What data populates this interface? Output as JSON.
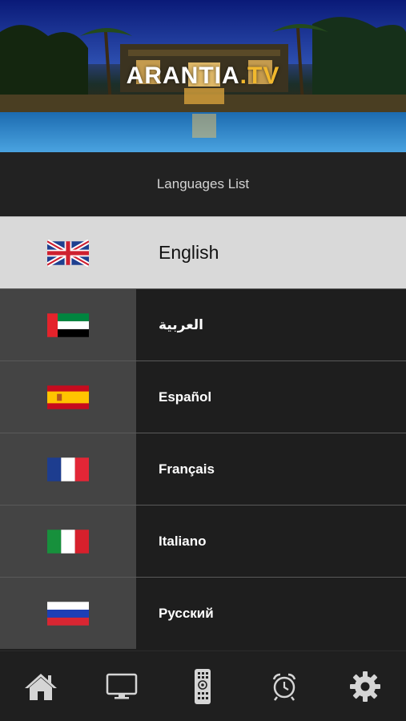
{
  "header": {
    "logo_main": "ARANTIA",
    "logo_tld": ".TV"
  },
  "title": "Languages List",
  "languages": [
    {
      "label": "English",
      "flag": "uk-flag",
      "selected": true
    },
    {
      "label": "العربية",
      "flag": "uae-flag",
      "selected": false
    },
    {
      "label": "Español",
      "flag": "spain-flag",
      "selected": false
    },
    {
      "label": "Français",
      "flag": "france-flag",
      "selected": false
    },
    {
      "label": "Italiano",
      "flag": "italy-flag",
      "selected": false
    },
    {
      "label": "Русский",
      "flag": "russia-flag",
      "selected": false
    }
  ],
  "bottom_nav": [
    {
      "icon": "home-icon"
    },
    {
      "icon": "tv-icon"
    },
    {
      "icon": "remote-control-icon"
    },
    {
      "icon": "alarm-clock-icon"
    },
    {
      "icon": "gear-icon"
    }
  ],
  "colors": {
    "selected_row": "#d9d9d9",
    "row_flag_bg": "#444444",
    "row_label_bg": "#1e1e1e",
    "accent": "#f1b82d"
  }
}
